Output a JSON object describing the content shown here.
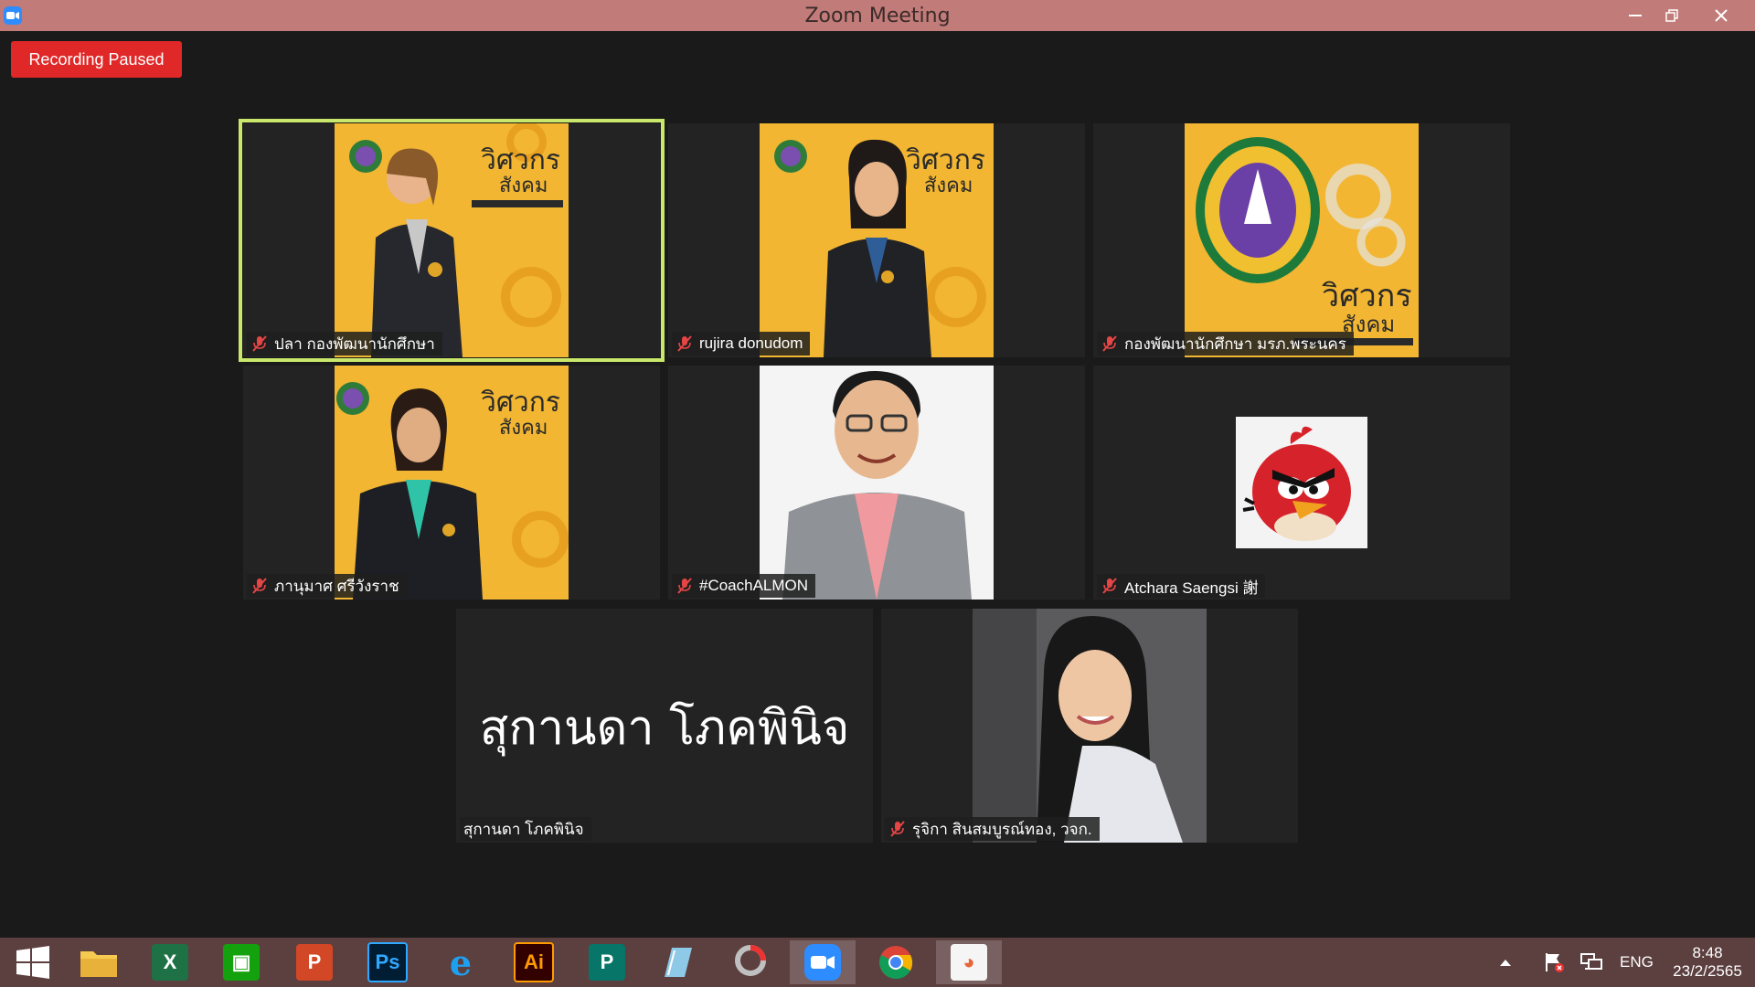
{
  "window": {
    "title": "Zoom Meeting",
    "controls": [
      "minimize",
      "restore",
      "close"
    ]
  },
  "recording": {
    "label": "Recording Paused"
  },
  "participants": [
    {
      "name": "ปลา กองพัฒนานักศึกษา",
      "muted": true,
      "active_speaker": true,
      "video": "poster-woman-orange-bg"
    },
    {
      "name": "rujira donudom",
      "muted": true,
      "active_speaker": false,
      "video": "poster-woman-orange-bg"
    },
    {
      "name": "กองพัฒนานักศึกษา มรภ.พระนคร",
      "muted": true,
      "active_speaker": false,
      "video": "university-logo-poster"
    },
    {
      "name": "ภานุมาศ ศรีวังราช",
      "muted": true,
      "active_speaker": false,
      "video": "poster-woman-orange-bg"
    },
    {
      "name": "#CoachALMON",
      "muted": true,
      "active_speaker": false,
      "video": "man-white-bg"
    },
    {
      "name": "Atchara Saengsi 謝",
      "muted": true,
      "active_speaker": false,
      "video": "red-bird-avatar"
    },
    {
      "name": "สุกานดา โภคพินิจ",
      "display_text": "สุกานดา โภคพินิจ",
      "muted": false,
      "active_speaker": false,
      "video": "none"
    },
    {
      "name": "รุจิกา สินสมบูรณ์ทอง, วจก.",
      "muted": true,
      "active_speaker": false,
      "video": "woman-selfie"
    }
  ],
  "taskbar": {
    "apps": [
      "start",
      "file-explorer",
      "excel",
      "store",
      "powerpoint",
      "photoshop",
      "internet-explorer",
      "illustrator",
      "publisher",
      "notes",
      "photoscape",
      "zoom",
      "chrome",
      "office"
    ],
    "active_app": "zoom",
    "tray": {
      "language": "ENG",
      "time": "8:48",
      "date": "23/2/2565"
    }
  },
  "colors": {
    "titlebar": "#c17b78",
    "recording": "#e02828",
    "active_outline": "#c9e76a",
    "taskbar": "#5c3f3f",
    "poster_orange": "#f2b632"
  }
}
